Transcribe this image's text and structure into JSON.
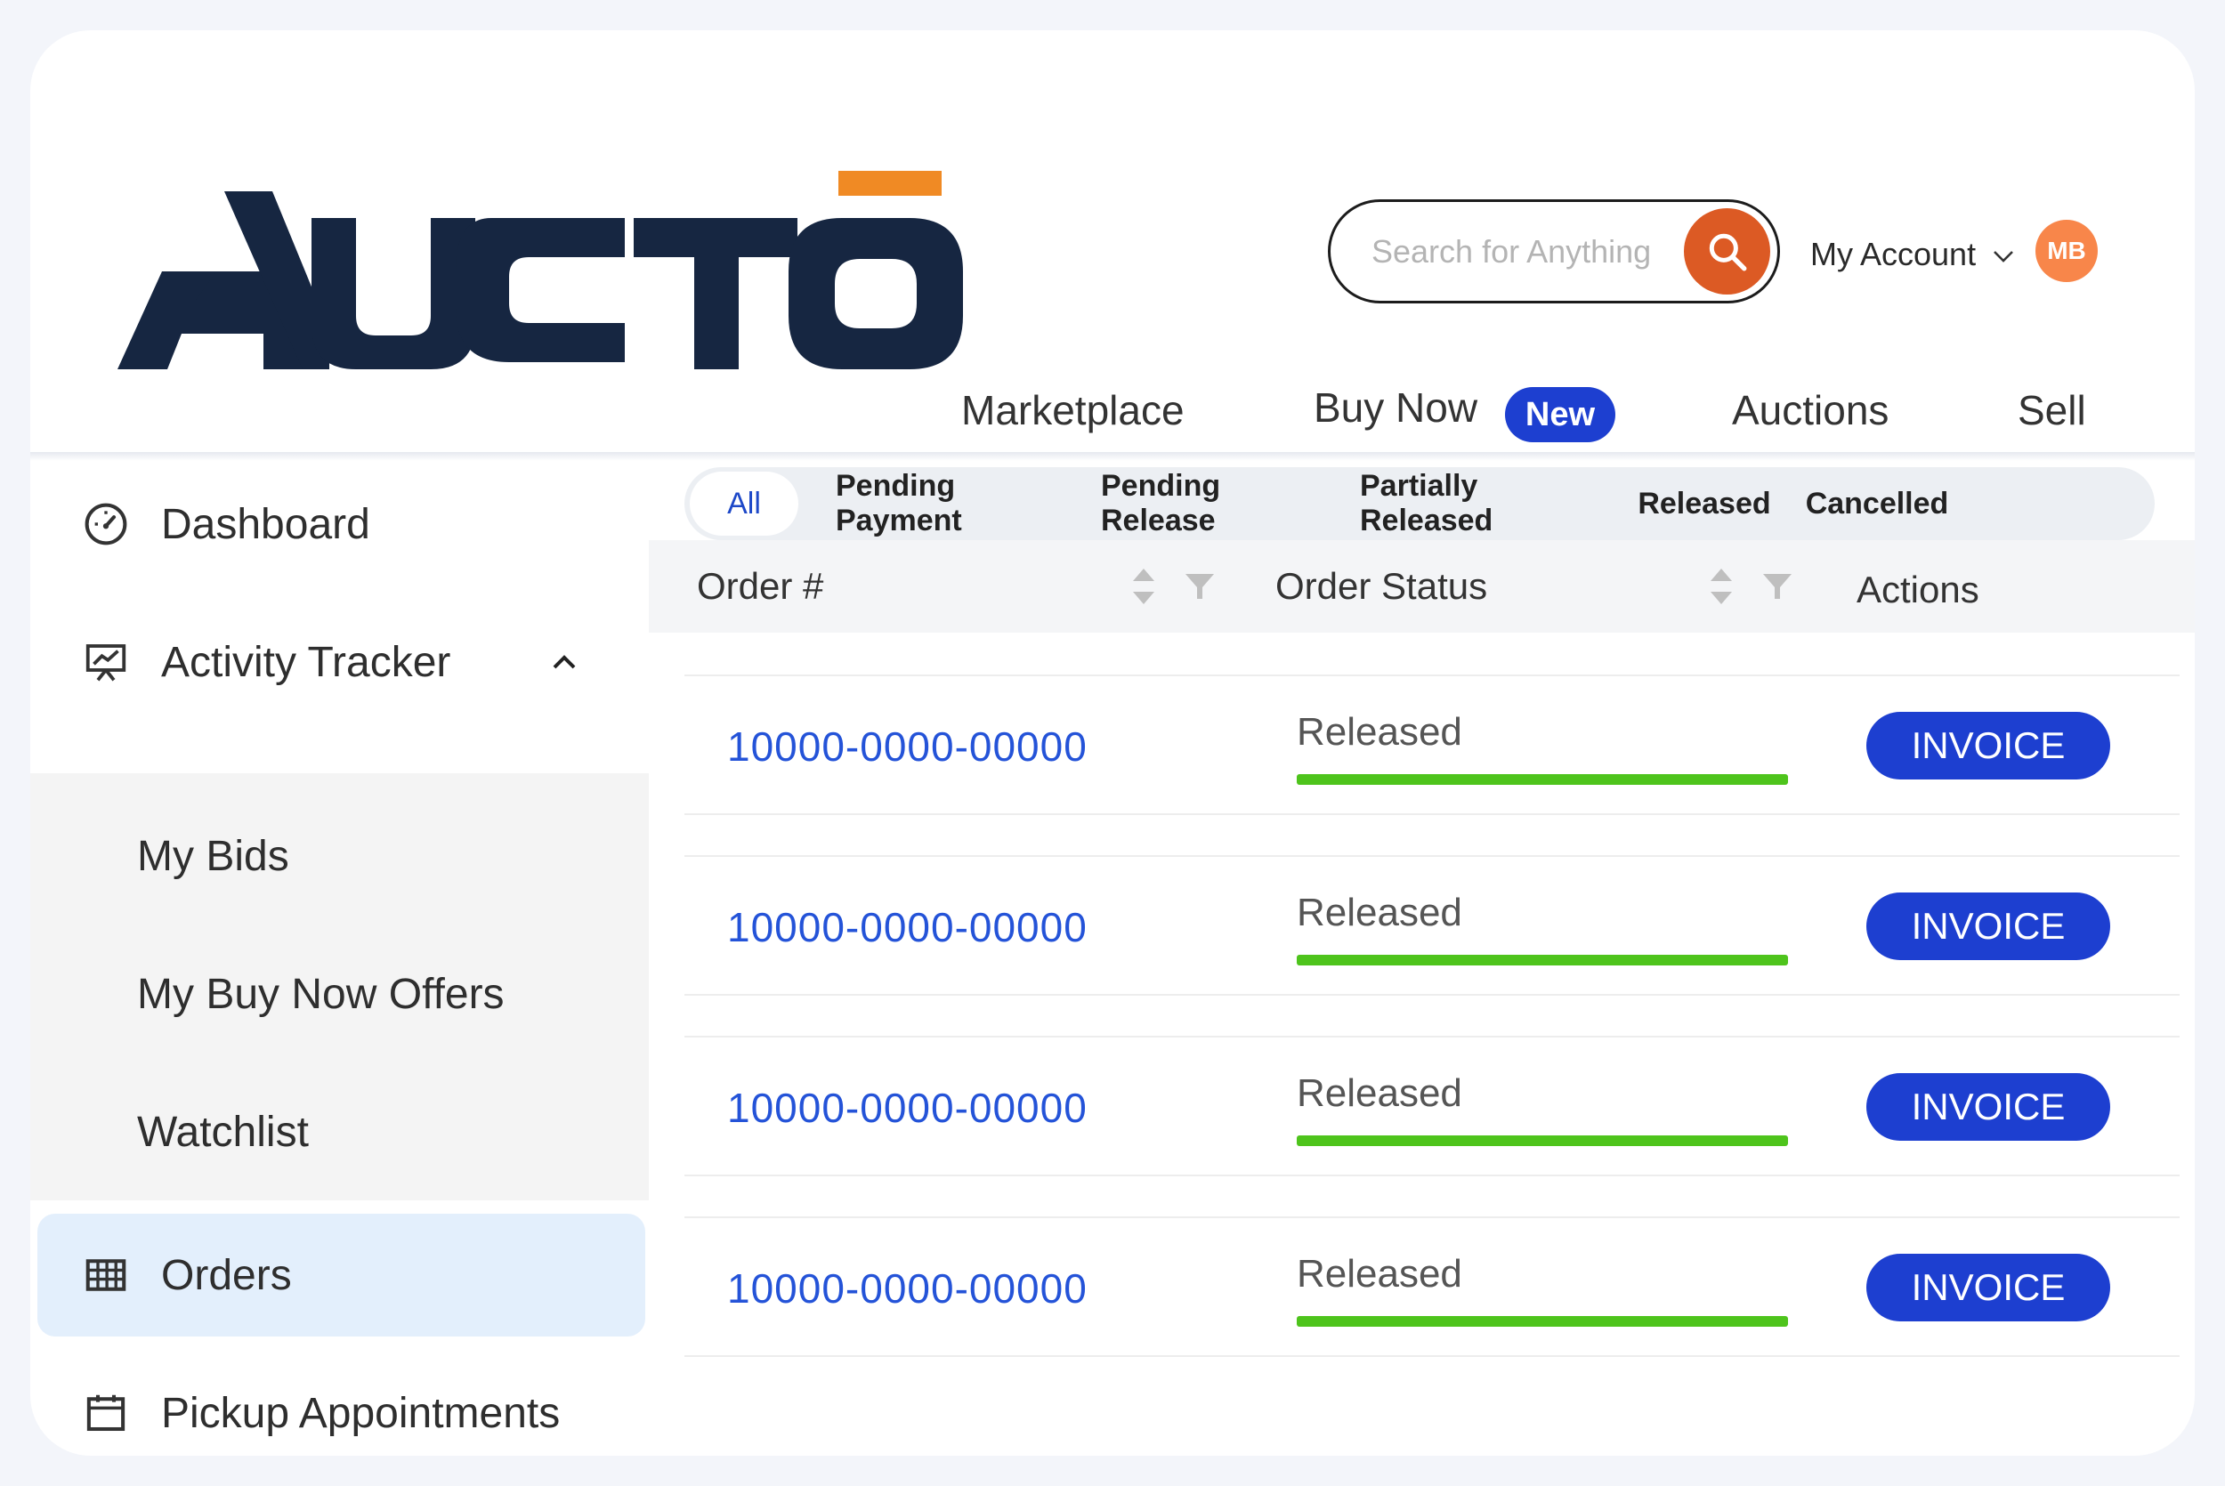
{
  "brand": {
    "name": "AUCTO",
    "logo_color": "#162641",
    "accent_color": "#f08a24"
  },
  "header": {
    "search": {
      "placeholder": "Search for Anything",
      "value": ""
    },
    "account": {
      "label": "My Account",
      "initials": "MB"
    },
    "nav": {
      "marketplace": "Marketplace",
      "buy_now": "Buy Now",
      "new_badge": "New",
      "auctions": "Auctions",
      "sell": "Sell"
    }
  },
  "sidebar": {
    "dashboard": "Dashboard",
    "activity_tracker": "Activity Tracker",
    "sub_items": [
      "My Bids",
      "My Buy Now Offers",
      "Watchlist"
    ],
    "orders": "Orders",
    "pickup": "Pickup Appointments"
  },
  "filters": [
    "All",
    "Pending Payment",
    "Pending Release",
    "Partially Released",
    "Released",
    "Cancelled"
  ],
  "active_filter": "All",
  "table": {
    "columns": {
      "order": "Order #",
      "status": "Order Status",
      "actions": "Actions"
    },
    "rows": [
      {
        "order": "10000-0000-00000",
        "status": "Released",
        "action": "INVOICE",
        "progress": 1.0
      },
      {
        "order": "10000-0000-00000",
        "status": "Released",
        "action": "INVOICE",
        "progress": 1.0
      },
      {
        "order": "10000-0000-00000",
        "status": "Released",
        "action": "INVOICE",
        "progress": 1.0
      },
      {
        "order": "10000-0000-00000",
        "status": "Released",
        "action": "INVOICE",
        "progress": 1.0
      }
    ]
  },
  "colors": {
    "primary_button": "#1d3fd0",
    "search_button": "#dc5a24",
    "avatar": "#f8864a",
    "status_green": "#4ec41c",
    "link": "#2453d8",
    "sidebar_active": "#e3effc"
  }
}
